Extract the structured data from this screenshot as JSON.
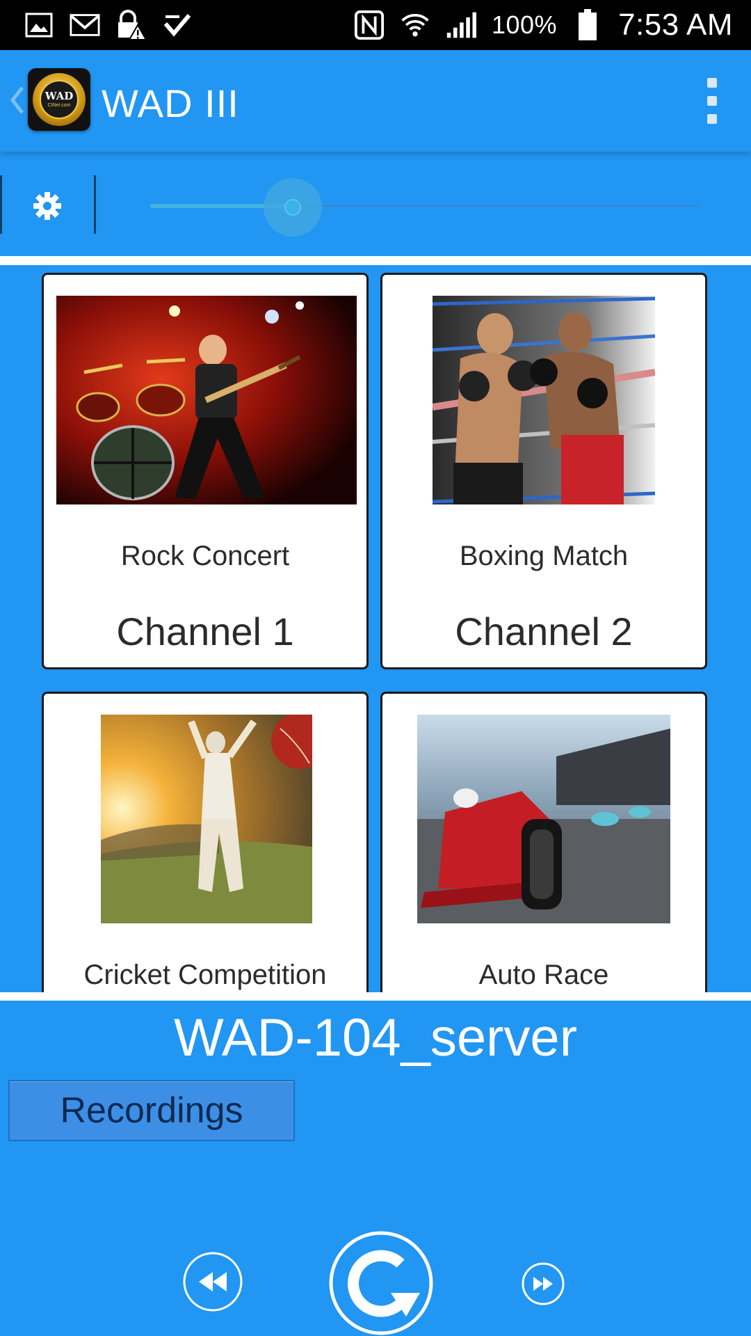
{
  "status_bar": {
    "battery_percent": "100%",
    "time": "7:53 AM",
    "icons": [
      "gallery-icon",
      "gmail-icon",
      "lock-warning-icon",
      "checkbox-icon",
      "nfc-icon",
      "wifi-icon",
      "signal-icon",
      "battery-icon"
    ]
  },
  "action_bar": {
    "title": "WAD III",
    "logo_text": "WAD",
    "logo_subtext": "CINet.com"
  },
  "controls": {
    "slider_value": 0.26
  },
  "channels": [
    {
      "name": "Rock Concert",
      "channel": "Channel 1",
      "image": "rock-concert-image"
    },
    {
      "name": "Boxing Match",
      "channel": "Channel 2",
      "image": "boxing-match-image"
    },
    {
      "name": "Cricket Competition",
      "channel": "",
      "image": "cricket-image"
    },
    {
      "name": "Auto Race",
      "channel": "",
      "image": "auto-race-image"
    }
  ],
  "server": {
    "name": "WAD-104_server"
  },
  "recordings": {
    "label": "Recordings"
  },
  "colors": {
    "background": "#2196f3",
    "status_bar": "#000000",
    "tile": "#ffffff"
  }
}
